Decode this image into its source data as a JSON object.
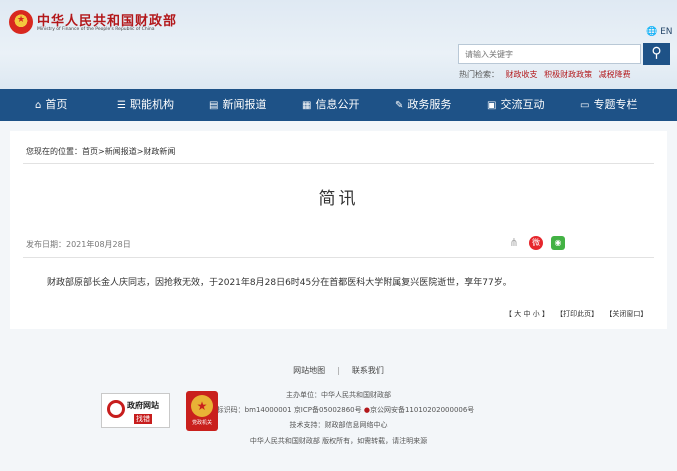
{
  "header": {
    "logo_cn": "中华人民共和国财政部",
    "logo_en": "Ministry of Finance of the People's Republic of China",
    "lang": "EN",
    "search_placeholder": "请输入关键字",
    "hot_label": "热门检索：",
    "hot_items": [
      "财政收支",
      "积极财政政策",
      "减税降费"
    ]
  },
  "nav": {
    "items": [
      {
        "label": "首页",
        "icon": "home-icon"
      },
      {
        "label": "职能机构",
        "icon": "org-icon"
      },
      {
        "label": "新闻报道",
        "icon": "news-icon"
      },
      {
        "label": "信息公开",
        "icon": "info-icon"
      },
      {
        "label": "政务服务",
        "icon": "service-icon"
      },
      {
        "label": "交流互动",
        "icon": "interaction-icon"
      },
      {
        "label": "专题专栏",
        "icon": "topic-icon"
      }
    ]
  },
  "article": {
    "breadcrumb": "您现在的位置：首页>新闻报道>财政新闻",
    "title": "简讯",
    "pubdate": "发布日期：2021年08月28日",
    "body": "财政部原部长金人庆同志，因抢救无效，于2021年8月28日6时45分在首都医科大学附属复兴医院逝世，享年77岁。",
    "font_size_label": "【 大 中 小 】",
    "print_label": "【打印此页】",
    "close_label": "【关闭窗口】"
  },
  "footer": {
    "sitemap": "网站地图",
    "separator": "|",
    "contact": "联系我们",
    "sponsor": "主办单位：中华人民共和国财政部",
    "site_id": "网站标识码：bm14000001  京ICP备05002860号",
    "police": "京公网安备11010202000006号",
    "tech": "技术支持：财政部信息网络中心",
    "copyright": "中华人民共和国财政部  版权所有，如需转载，请注明来源",
    "gov_badge_title": "政府网站",
    "gov_badge_sub": "找错",
    "party_badge": "党政机关"
  },
  "colors": {
    "nav_bg": "#1e5287",
    "brand_red": "#b3181b",
    "weibo": "#e6262c",
    "wechat": "#43b244"
  }
}
